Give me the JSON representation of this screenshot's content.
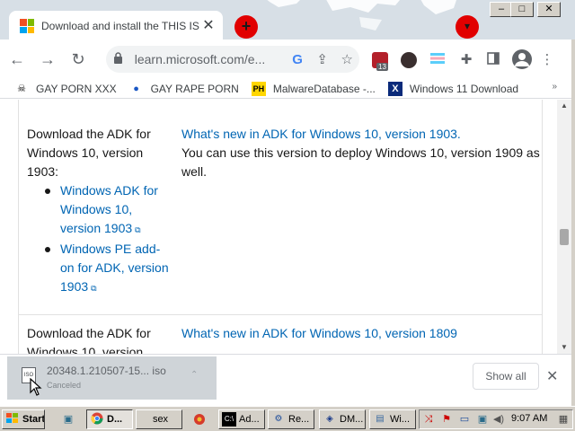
{
  "browser": {
    "tab": {
      "title": "Download and install the THIS IS C",
      "close_glyph": "✕"
    },
    "new_tab_glyph": "+",
    "tab_search_glyph": "▾",
    "window_controls": {
      "minimize": "–",
      "maximize": "□",
      "close": "✕"
    },
    "nav": {
      "back": "←",
      "forward": "→",
      "reload": "↻"
    },
    "omnibox": {
      "url": "learn.microsoft.com/e...",
      "google_glyph": "G",
      "share_glyph": "⇪",
      "star_glyph": "☆"
    },
    "extensions": {
      "badge_count": "13"
    },
    "bookmarks": [
      {
        "icon": "skull-icon",
        "glyph": "☠",
        "label": "GAY PORN XXX"
      },
      {
        "icon": "globe-icon",
        "glyph": "🌐",
        "label": "GAY RAPE PORN"
      },
      {
        "icon": "ph-icon",
        "glyph": "PH",
        "label": "MalwareDatabase -..."
      },
      {
        "icon": "x-icon",
        "glyph": "X",
        "label": "Windows 11 Download"
      }
    ],
    "bookmarks_more": "»"
  },
  "page": {
    "rows": [
      {
        "left_heading": "Download the ADK for Windows 10, version 1903:",
        "links": [
          "Windows ADK for Windows 10, version 1903",
          "Windows PE add-on for ADK, version 1903"
        ],
        "right_link": "What's new in ADK for Windows 10, version 1903.",
        "right_text": "You can use this version to deploy Windows 10, version 1909 as well."
      },
      {
        "left_heading": "Download the ADK for Windows 10, version",
        "right_link": "What's new in ADK for Windows 10, version 1809"
      }
    ],
    "external_glyph": "⧉"
  },
  "scrollbar": {
    "position_fraction": 0.55
  },
  "download_shelf": {
    "item": {
      "file_name": "20348.1.210507-15... iso",
      "status": "Canceled",
      "icon_text": "ISO"
    },
    "show_all_label": "Show all",
    "close_glyph": "✕"
  },
  "taskbar": {
    "start_label": "Start",
    "buttons": [
      {
        "label": "D...",
        "icon": "chrome-icon",
        "pressed": true
      },
      {
        "label": "sex",
        "icon": "blank-icon",
        "pressed": false
      },
      {
        "label": "Ad...",
        "icon": "cmd-icon",
        "pressed": false
      },
      {
        "label": "Re...",
        "icon": "regedit-icon",
        "pressed": false
      },
      {
        "label": "DM...",
        "icon": "dm-icon",
        "pressed": false
      },
      {
        "label": "Wi...",
        "icon": "winpe-icon",
        "pressed": false
      }
    ],
    "clock": "9:07 AM"
  },
  "colors": {
    "link": "#0065b3",
    "tab_strip": "#d7dfe6",
    "red_button": "#e10000",
    "taskbar": "#d4d0c8"
  }
}
